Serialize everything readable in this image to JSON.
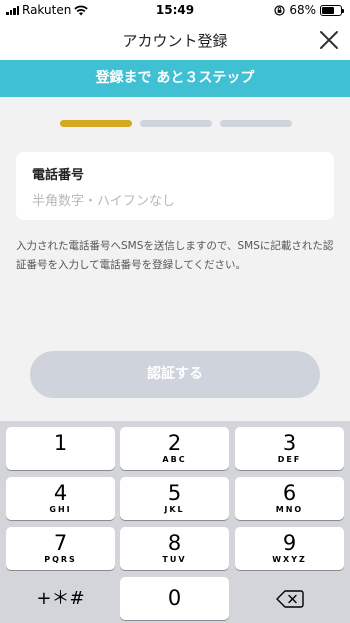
{
  "status_bar": {
    "carrier": "Rakuten",
    "time": "15:49",
    "battery": "68%",
    "battery_level": 0.68
  },
  "header": {
    "title": "アカウント登録",
    "close_icon": "close-icon"
  },
  "banner": {
    "text": "登録まで あと３ステップ",
    "color": "#3fc0d3"
  },
  "progress": {
    "total_steps": 3,
    "current_step": 1,
    "active_color": "#d4a81f",
    "inactive_color": "#cfd3dc"
  },
  "phone_field": {
    "label": "電話番号",
    "placeholder": "半角数字・ハイフンなし",
    "value": ""
  },
  "info": {
    "text": "入力された電話番号へSMSを送信しますので、SMSに記載された認証番号を入力して電話番号を登録してください。"
  },
  "verify_button": {
    "label": "認証する",
    "enabled": false
  },
  "keypad": {
    "keys": [
      {
        "num": "1",
        "letters": ""
      },
      {
        "num": "2",
        "letters": "ABC"
      },
      {
        "num": "3",
        "letters": "DEF"
      },
      {
        "num": "4",
        "letters": "GHI"
      },
      {
        "num": "5",
        "letters": "JKL"
      },
      {
        "num": "6",
        "letters": "MNO"
      },
      {
        "num": "7",
        "letters": "PQRS"
      },
      {
        "num": "8",
        "letters": "TUV"
      },
      {
        "num": "9",
        "letters": "WXYZ"
      }
    ],
    "symbols_label": "+＊#",
    "zero": "0",
    "delete_icon": "backspace-icon"
  }
}
